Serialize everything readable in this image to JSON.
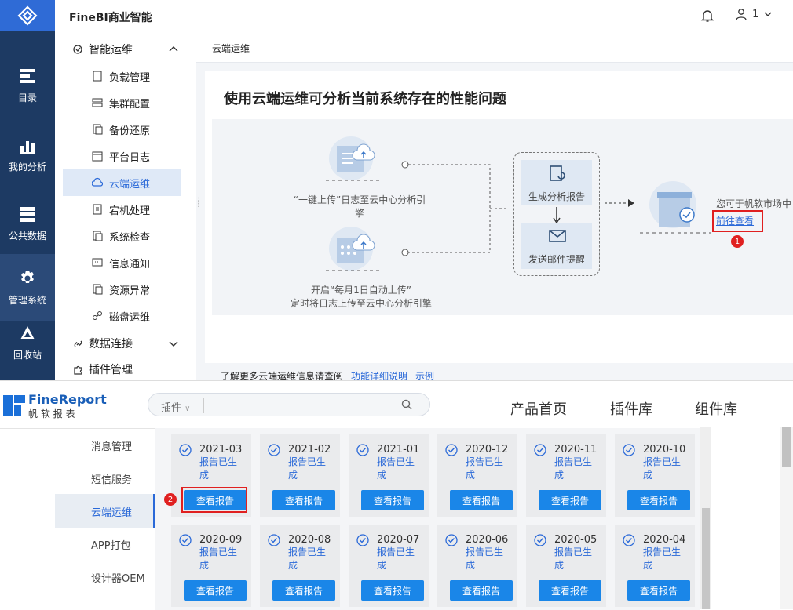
{
  "header": {
    "brand": "FineBI商业智能",
    "user": "1"
  },
  "rail": [
    {
      "label": "目录",
      "icon": "catalog-icon"
    },
    {
      "label": "我的分析",
      "icon": "chart-icon"
    },
    {
      "label": "公共数据",
      "icon": "database-icon"
    },
    {
      "label": "管理系统",
      "icon": "gear-icon",
      "active": true
    },
    {
      "label": "回收站",
      "icon": "recycle-icon"
    }
  ],
  "sidenav": {
    "group1": "智能运维",
    "items": [
      "负载管理",
      "集群配置",
      "备份还原",
      "平台日志",
      "云端运维",
      "宕机处理",
      "系统检查",
      "信息通知",
      "资源异常",
      "磁盘运维"
    ],
    "group2": "数据连接",
    "group3": "插件管理"
  },
  "content": {
    "breadcrumb": "云端运维",
    "headline": "使用云端运维可分析当前系统存在的性能问题",
    "upload_caption": "“一键上传”日志至云中心分析引擎",
    "auto_caption_1": "开启“每月1日自动上传”",
    "auto_caption_2": "定时将日志上传至云中心分析引擎",
    "step_report": "生成分析报告",
    "step_mail": "发送邮件提醒",
    "market_text": "您可于帆软市场中",
    "goto_link": "前往查看",
    "more_text": "了解更多云端运维信息请查阅",
    "link_detail": "功能详细说明",
    "link_example": "示例",
    "marker1": "1"
  },
  "finereport": {
    "logo_en": "FineReport",
    "logo_cn": "帆 软 报 表",
    "search_category": "插件",
    "nav": [
      "产品首页",
      "插件库",
      "组件库"
    ],
    "subnav": [
      "消息管理",
      "短信服务",
      "云端运维",
      "APP打包",
      "设计器OEM"
    ],
    "status": "报告已生成",
    "button": "查看报告",
    "dates": [
      "2021-03",
      "2021-02",
      "2021-01",
      "2020-12",
      "2020-11",
      "2020-10",
      "2020-09",
      "2020-08",
      "2020-07",
      "2020-06",
      "2020-05",
      "2020-04"
    ],
    "marker2": "2"
  },
  "colors": {
    "rail": "#1d3a63",
    "accent": "#2a69d8",
    "button": "#1a86e8",
    "marker": "#e02020"
  }
}
